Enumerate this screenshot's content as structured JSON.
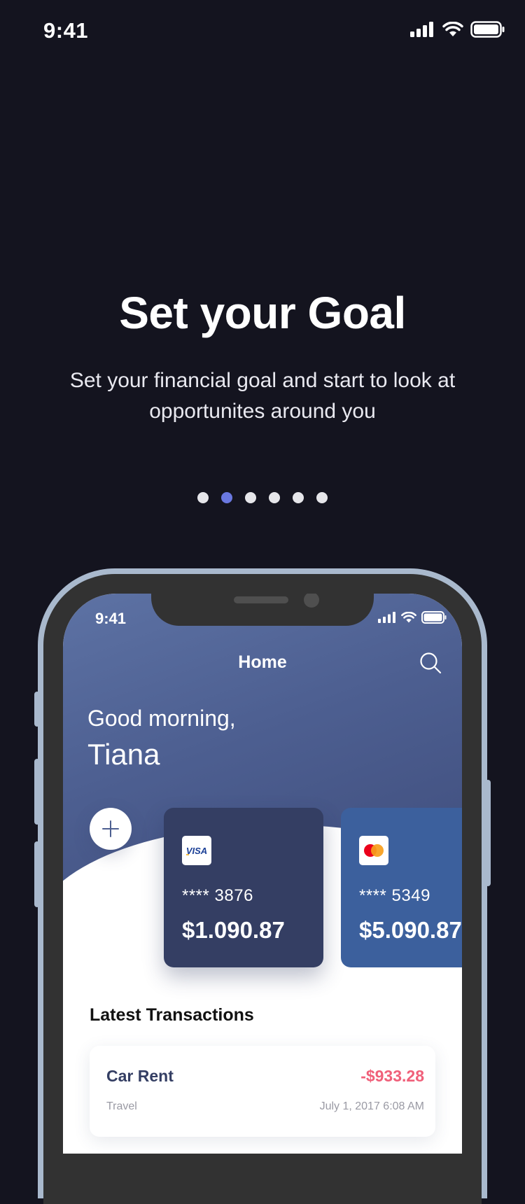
{
  "status_bar": {
    "time": "9:41"
  },
  "onboarding": {
    "title": "Set your Goal",
    "subtitle": "Set your financial goal and start to look at opportunites around you",
    "page_count": 6,
    "active_page_index": 1
  },
  "colors": {
    "background": "#14141f",
    "accent": "#6a78e0",
    "visa_card": "#343e63",
    "master_card": "#3c609d",
    "negative_amount": "#f0607a"
  },
  "phone_screen": {
    "status_time": "9:41",
    "nav_title": "Home",
    "greeting": "Good morning,",
    "user_name": "Tiana",
    "cards": [
      {
        "brand": "VISA",
        "number": "**** 3876",
        "balance": "$1.090.87",
        "icon": "visa-logo-icon"
      },
      {
        "brand": "Mastercard",
        "number": "**** 5349",
        "balance": "$5.090.87",
        "icon": "mastercard-logo-icon"
      }
    ],
    "section_title": "Latest Transactions",
    "transactions": [
      {
        "title": "Car Rent",
        "amount": "-$933.28",
        "category": "Travel",
        "date": "July 1, 2017 6:08 AM"
      }
    ]
  }
}
